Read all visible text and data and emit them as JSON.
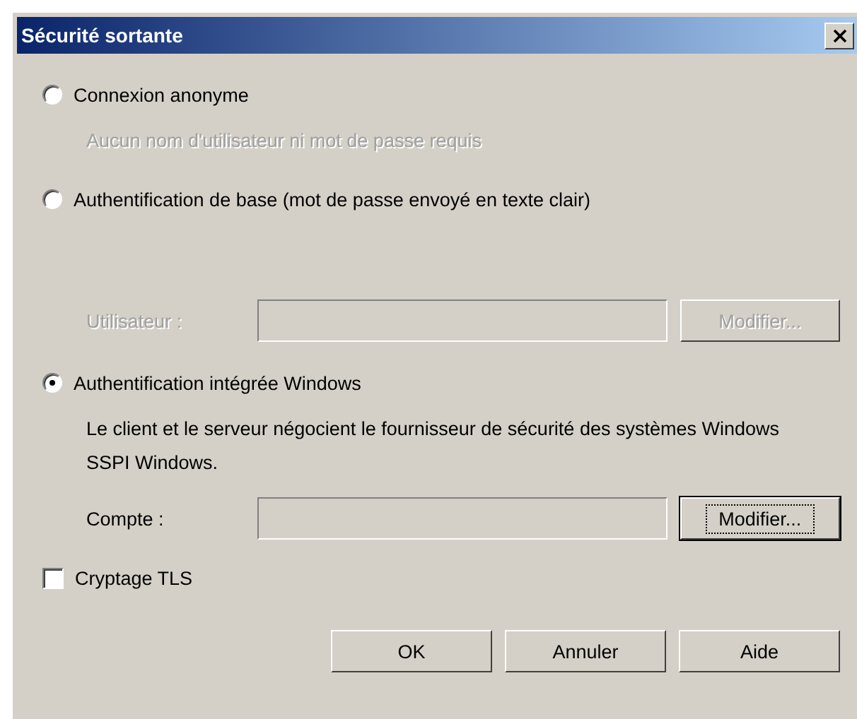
{
  "window": {
    "title": "Sécurité sortante"
  },
  "options": [
    {
      "label": "Connexion anonyme",
      "selected": false,
      "description": "Aucun nom d'utilisateur ni mot de passe requis",
      "description_disabled": true
    },
    {
      "label": "Authentification de base (mot de passe envoyé en texte clair)",
      "selected": false,
      "field": {
        "label": "Utilisateur :",
        "disabled": true,
        "button": "Modifier...",
        "button_focused": false
      }
    },
    {
      "label": "Authentification intégrée Windows",
      "selected": true,
      "description": "Le client et le serveur négocient le fournisseur de sécurité des systèmes Windows SSPI Windows.",
      "description_disabled": false,
      "field": {
        "label": "Compte :",
        "disabled": false,
        "button": "Modifier...",
        "button_focused": true
      }
    }
  ],
  "tls": {
    "label": "Cryptage TLS",
    "checked": false
  },
  "buttons": [
    "OK",
    "Annuler",
    "Aide"
  ]
}
